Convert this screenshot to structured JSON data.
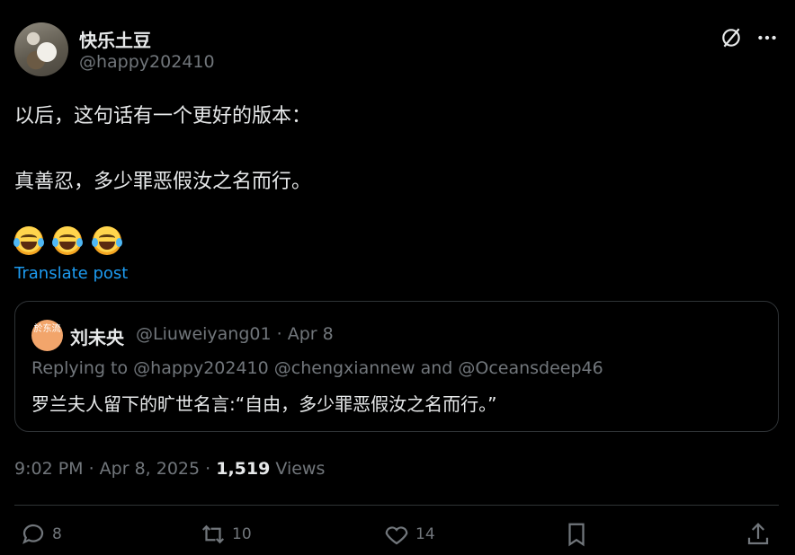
{
  "author": {
    "name": "快乐土豆",
    "handle": "@happy202410"
  },
  "post": {
    "line1": "以后，这句话有一个更好的版本：",
    "line2": "真善忍，多少罪恶假汝之名而行。",
    "emojis": [
      "face-with-tears-of-joy",
      "face-with-tears-of-joy",
      "face-with-tears-of-joy"
    ],
    "translate_label": "Translate post"
  },
  "quote": {
    "avatar_text": "於东流",
    "name": "刘未央",
    "meta": "@Liuweiyang01 · Apr 8",
    "replying": "Replying to @happy202410 @chengxiannew and @Oceansdeep46",
    "text": "罗兰夫人留下的旷世名言:“自由，多少罪恶假汝之名而行。”"
  },
  "meta": {
    "time": "9:02 PM · Apr 8, 2025 · ",
    "views_count": "1,519",
    "views_label": " Views"
  },
  "actions": {
    "replies": "8",
    "reposts": "10",
    "likes": "14"
  },
  "colors": {
    "background": "#000000",
    "text": "#e7e9ea",
    "muted": "#71767b",
    "link": "#1d9bf0",
    "border": "#2f3336"
  }
}
